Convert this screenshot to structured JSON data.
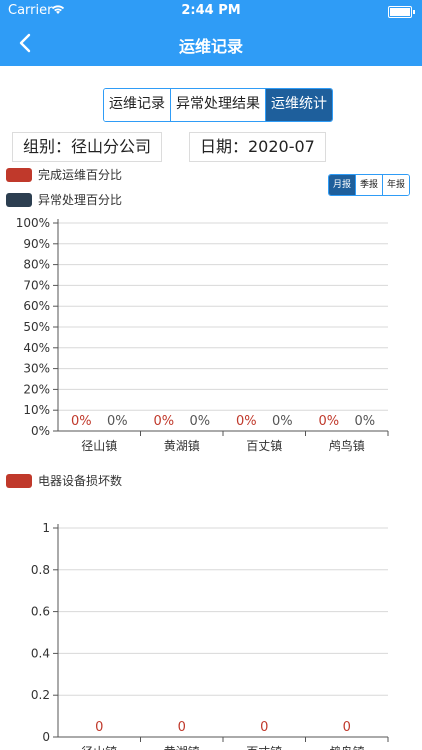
{
  "status_bar": {
    "carrier": "Carrier",
    "time": "2:44 PM"
  },
  "nav": {
    "title": "运维记录"
  },
  "tabs": [
    {
      "label": "运维记录",
      "active": false
    },
    {
      "label": "异常处理结果",
      "active": false
    },
    {
      "label": "运维统计",
      "active": true
    }
  ],
  "filters": {
    "org": "组别：径山分公司",
    "date": "日期：2020-07"
  },
  "period_buttons": [
    {
      "label": "月报",
      "active": true
    },
    {
      "label": "季报",
      "active": false
    },
    {
      "label": "年报",
      "active": false
    }
  ],
  "colors": {
    "primary": "#2f9cf6",
    "dark_tab": "#1e5f9c",
    "series_red": "#c0392b",
    "series_dark": "#2c3e50",
    "grid": "#d8d8d8"
  },
  "chart_data": [
    {
      "type": "bar",
      "categories": [
        "径山镇",
        "黄湖镇",
        "百丈镇",
        "鸬鸟镇"
      ],
      "series": [
        {
          "name": "完成运维百分比",
          "values": [
            0,
            0,
            0,
            0
          ],
          "labels": [
            "0%",
            "0%",
            "0%",
            "0%"
          ]
        },
        {
          "name": "异常处理百分比",
          "values": [
            0,
            0,
            0,
            0
          ],
          "labels": [
            "0%",
            "0%",
            "0%",
            "0%"
          ]
        }
      ],
      "yticks": [
        "0%",
        "10%",
        "20%",
        "30%",
        "40%",
        "50%",
        "60%",
        "70%",
        "80%",
        "90%",
        "100%"
      ],
      "ylim": [
        0,
        100
      ]
    },
    {
      "type": "bar",
      "categories": [
        "径山镇",
        "黄湖镇",
        "百丈镇",
        "鸬鸟镇"
      ],
      "series": [
        {
          "name": "电器设备损坏数",
          "values": [
            0,
            0,
            0,
            0
          ],
          "labels": [
            "0",
            "0",
            "0",
            "0"
          ]
        }
      ],
      "yticks": [
        "0",
        "0.2",
        "0.4",
        "0.6",
        "0.8",
        "1"
      ],
      "ylim": [
        0,
        1
      ]
    }
  ]
}
